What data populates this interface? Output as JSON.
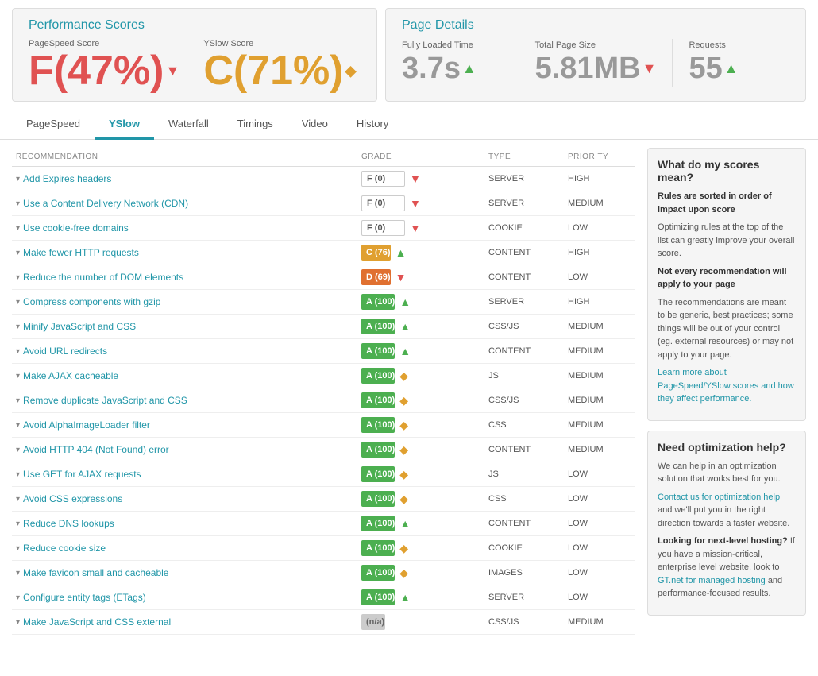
{
  "performance": {
    "title": "Performance Scores",
    "pagespeed": {
      "label": "PageSpeed Score",
      "value": "F(47%)",
      "arrow": "▼"
    },
    "yslow": {
      "label": "YSlow Score",
      "value": "C(71%)",
      "arrow": "◆"
    }
  },
  "pageDetails": {
    "title": "Page Details",
    "fullyLoaded": {
      "label": "Fully Loaded Time",
      "value": "3.7s",
      "arrow": "▲"
    },
    "totalSize": {
      "label": "Total Page Size",
      "value": "5.81MB",
      "arrow": "▼"
    },
    "requests": {
      "label": "Requests",
      "value": "55",
      "arrow": "▲"
    }
  },
  "tabs": [
    {
      "label": "PageSpeed",
      "active": false
    },
    {
      "label": "YSlow",
      "active": true
    },
    {
      "label": "Waterfall",
      "active": false
    },
    {
      "label": "Timings",
      "active": false
    },
    {
      "label": "Video",
      "active": false
    },
    {
      "label": "History",
      "active": false
    }
  ],
  "table": {
    "headers": [
      "RECOMMENDATION",
      "GRADE",
      "TYPE",
      "PRIORITY"
    ],
    "rows": [
      {
        "rec": "Add Expires headers",
        "grade": "F (0)",
        "gradeType": "red-text",
        "gradeIcon": "▼",
        "gradeIconClass": "red",
        "type": "SERVER",
        "priority": "HIGH"
      },
      {
        "rec": "Use a Content Delivery Network (CDN)",
        "grade": "F (0)",
        "gradeType": "red-text",
        "gradeIcon": "▼",
        "gradeIconClass": "red",
        "type": "SERVER",
        "priority": "MEDIUM"
      },
      {
        "rec": "Use cookie-free domains",
        "grade": "F (0)",
        "gradeType": "red-text",
        "gradeIcon": "▼",
        "gradeIconClass": "red",
        "type": "COOKIE",
        "priority": "LOW"
      },
      {
        "rec": "Make fewer HTTP requests",
        "grade": "C (76)",
        "gradeType": "orange",
        "gradeIcon": "▲",
        "gradeIconClass": "green",
        "type": "CONTENT",
        "priority": "HIGH"
      },
      {
        "rec": "Reduce the number of DOM elements",
        "grade": "D (69)",
        "gradeType": "orange2",
        "gradeIcon": "▼",
        "gradeIconClass": "red",
        "type": "CONTENT",
        "priority": "LOW"
      },
      {
        "rec": "Compress components with gzip",
        "grade": "A (100)",
        "gradeType": "green",
        "gradeIcon": "▲",
        "gradeIconClass": "green",
        "type": "SERVER",
        "priority": "HIGH"
      },
      {
        "rec": "Minify JavaScript and CSS",
        "grade": "A (100)",
        "gradeType": "green",
        "gradeIcon": "▲",
        "gradeIconClass": "green",
        "type": "CSS/JS",
        "priority": "MEDIUM"
      },
      {
        "rec": "Avoid URL redirects",
        "grade": "A (100)",
        "gradeType": "green",
        "gradeIcon": "▲",
        "gradeIconClass": "green",
        "type": "CONTENT",
        "priority": "MEDIUM"
      },
      {
        "rec": "Make AJAX cacheable",
        "grade": "A (100)",
        "gradeType": "green",
        "gradeIcon": "◆",
        "gradeIconClass": "gold",
        "type": "JS",
        "priority": "MEDIUM"
      },
      {
        "rec": "Remove duplicate JavaScript and CSS",
        "grade": "A (100)",
        "gradeType": "green",
        "gradeIcon": "◆",
        "gradeIconClass": "gold",
        "type": "CSS/JS",
        "priority": "MEDIUM"
      },
      {
        "rec": "Avoid AlphaImageLoader filter",
        "grade": "A (100)",
        "gradeType": "green",
        "gradeIcon": "◆",
        "gradeIconClass": "gold",
        "type": "CSS",
        "priority": "MEDIUM"
      },
      {
        "rec": "Avoid HTTP 404 (Not Found) error",
        "grade": "A (100)",
        "gradeType": "green",
        "gradeIcon": "◆",
        "gradeIconClass": "gold",
        "type": "CONTENT",
        "priority": "MEDIUM"
      },
      {
        "rec": "Use GET for AJAX requests",
        "grade": "A (100)",
        "gradeType": "green",
        "gradeIcon": "◆",
        "gradeIconClass": "gold",
        "type": "JS",
        "priority": "LOW"
      },
      {
        "rec": "Avoid CSS expressions",
        "grade": "A (100)",
        "gradeType": "green",
        "gradeIcon": "◆",
        "gradeIconClass": "gold",
        "type": "CSS",
        "priority": "LOW"
      },
      {
        "rec": "Reduce DNS lookups",
        "grade": "A (100)",
        "gradeType": "green",
        "gradeIcon": "▲",
        "gradeIconClass": "green",
        "type": "CONTENT",
        "priority": "LOW"
      },
      {
        "rec": "Reduce cookie size",
        "grade": "A (100)",
        "gradeType": "green",
        "gradeIcon": "◆",
        "gradeIconClass": "gold",
        "type": "COOKIE",
        "priority": "LOW"
      },
      {
        "rec": "Make favicon small and cacheable",
        "grade": "A (100)",
        "gradeType": "green",
        "gradeIcon": "◆",
        "gradeIconClass": "gold",
        "type": "IMAGES",
        "priority": "LOW"
      },
      {
        "rec": "Configure entity tags (ETags)",
        "grade": "A (100)",
        "gradeType": "green",
        "gradeIcon": "▲",
        "gradeIconClass": "green",
        "type": "SERVER",
        "priority": "LOW"
      },
      {
        "rec": "Make JavaScript and CSS external",
        "grade": "(n/a)",
        "gradeType": "na",
        "gradeIcon": "",
        "gradeIconClass": "",
        "type": "CSS/JS",
        "priority": "MEDIUM"
      }
    ]
  },
  "sidebar": {
    "scoresBox": {
      "title": "What do my scores mean?",
      "body1Label": "Rules are sorted in order of impact upon score",
      "body1": "Optimizing rules at the top of the list can greatly improve your overall score.",
      "body2Label": "Not every recommendation will apply to your page",
      "body2": "The recommendations are meant to be generic, best practices; some things will be out of your control (eg. external resources) or may not apply to your page.",
      "linkText": "Learn more about PageSpeed/YSlow scores and how they affect performance."
    },
    "optimizationBox": {
      "title": "Need optimization help?",
      "body1": "We can help in an optimization solution that works best for you.",
      "linkText1": "Contact us for optimization help",
      "body2": " and we'll put you in the right direction towards a faster website.",
      "body3Label": "Looking for next-level hosting?",
      "body3": " If you have a mission-critical, enterprise level website, look to ",
      "linkText2": "GT.net for managed hosting",
      "body4": " and performance-focused results."
    }
  }
}
